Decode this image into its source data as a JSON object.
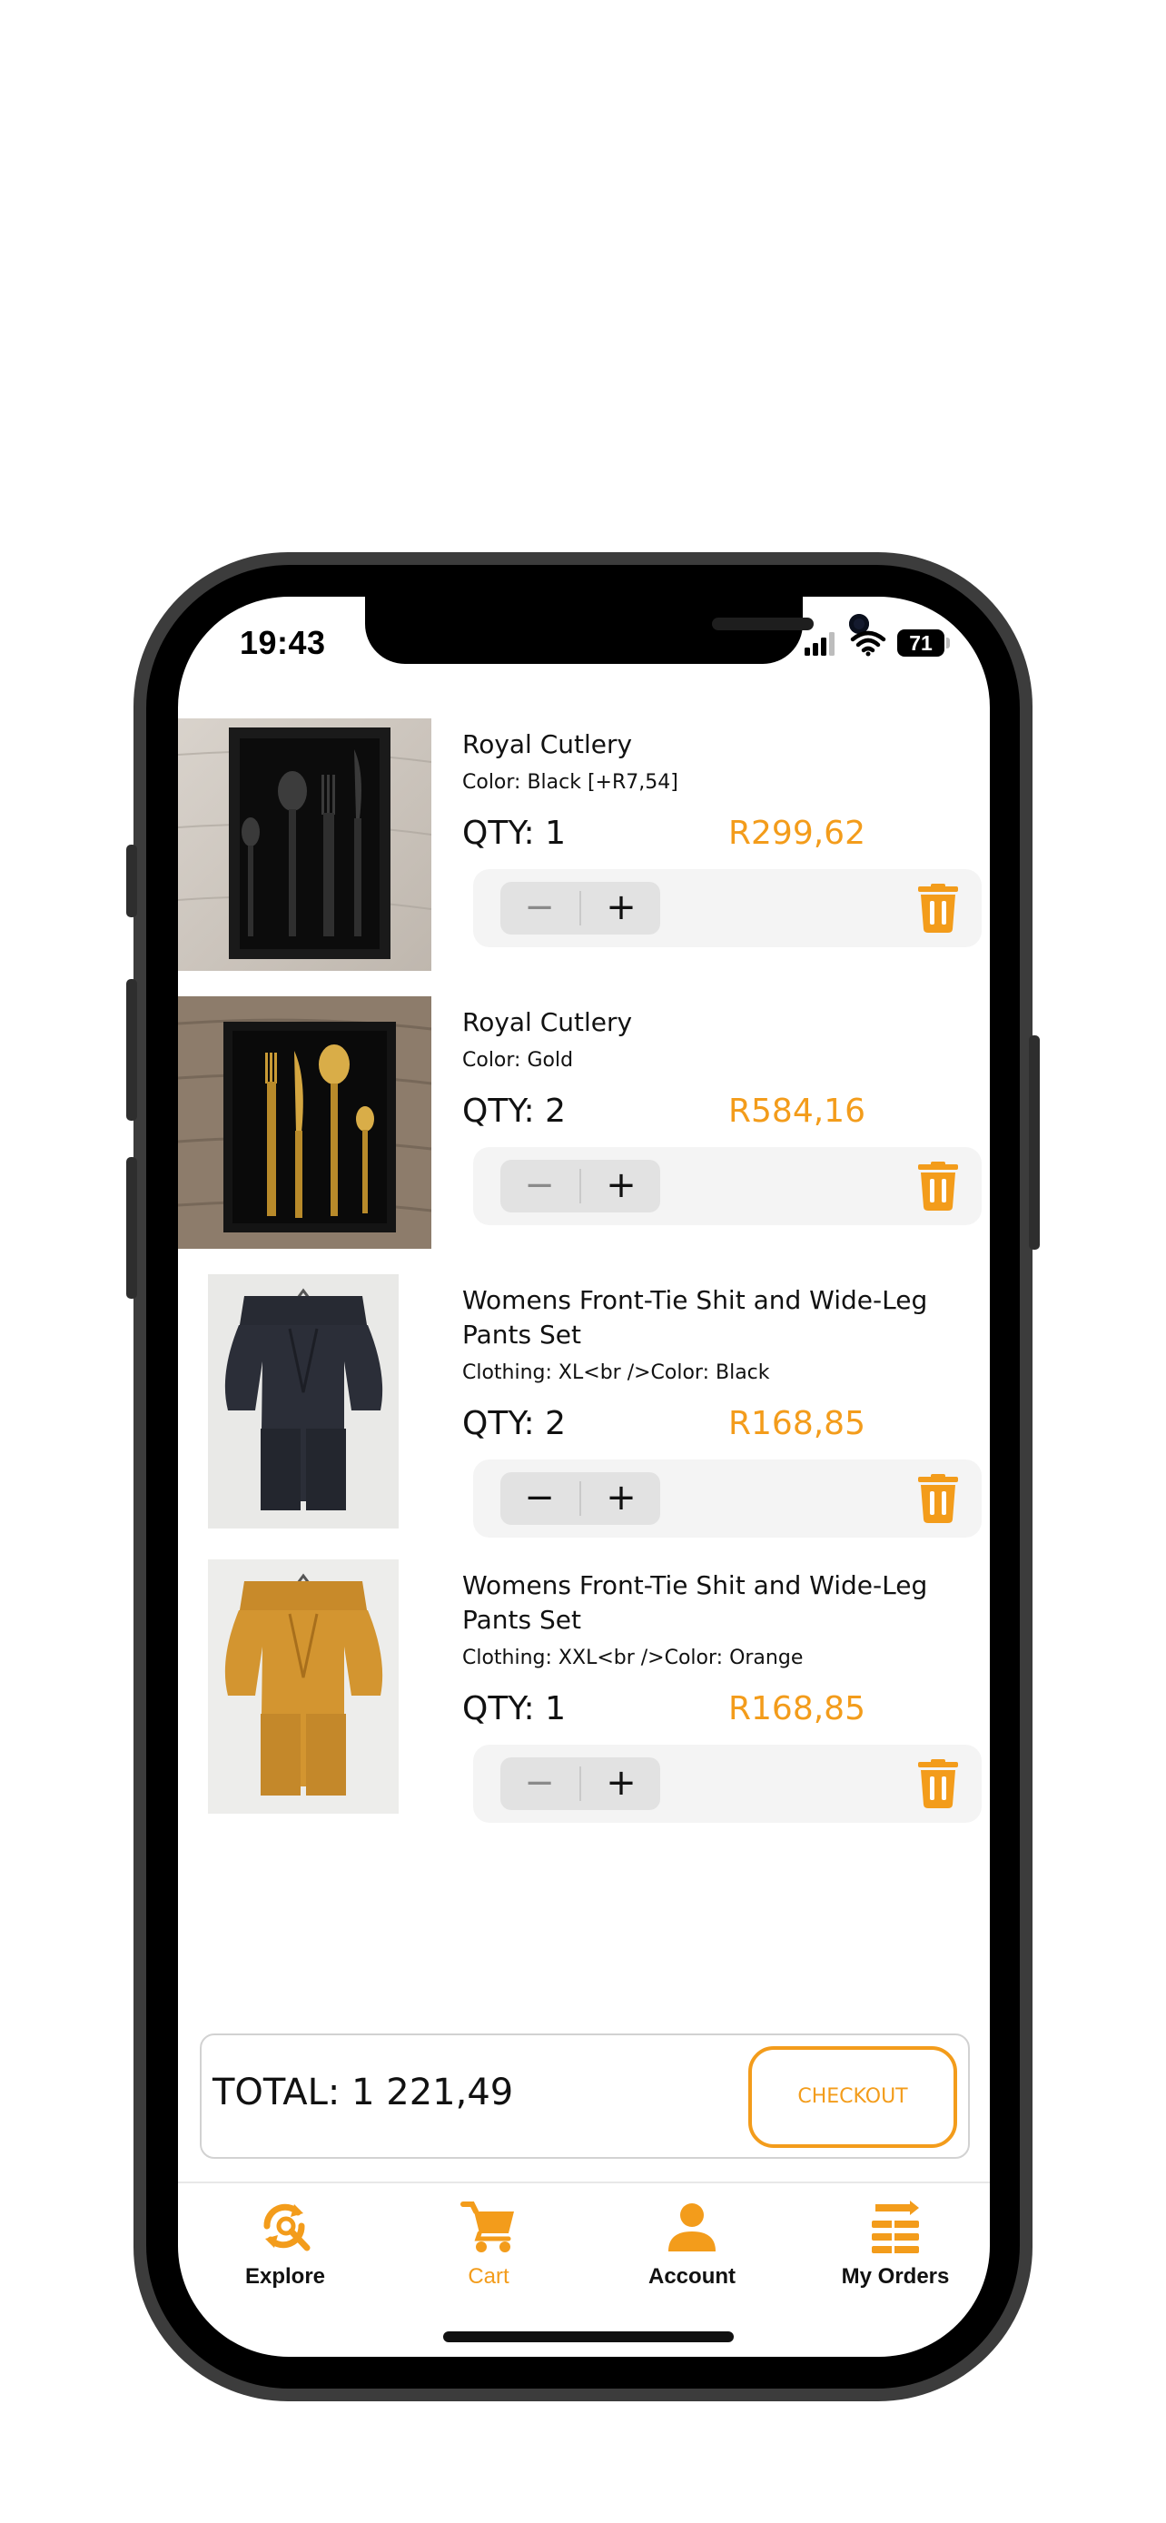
{
  "status_bar": {
    "time": "19:43",
    "battery": "71"
  },
  "colors": {
    "accent": "#f39c1b",
    "text": "#111111",
    "muted": "#8a8a8a"
  },
  "cart": {
    "items": [
      {
        "name": "Royal Cutlery",
        "variant": "Color: Black [+R7,54]",
        "qty": "QTY: 1",
        "price": "R299,62",
        "qty_value": 1,
        "minus_enabled": false
      },
      {
        "name": "Royal Cutlery",
        "variant": "Color: Gold",
        "qty": "QTY: 2",
        "price": "R584,16",
        "qty_value": 2,
        "minus_enabled": false
      },
      {
        "name": "Womens Front-Tie Shit and Wide-Leg Pants Set",
        "variant": "Clothing: XL<br />Color: Black",
        "qty": "QTY: 2",
        "price": "R168,85",
        "qty_value": 2,
        "minus_enabled": true
      },
      {
        "name": "Womens Front-Tie Shit and Wide-Leg Pants Set",
        "variant": "Clothing: XXL<br />Color: Orange",
        "qty": "QTY: 1",
        "price": "R168,85",
        "qty_value": 1,
        "minus_enabled": false
      }
    ],
    "stepper": {
      "minus": "−",
      "plus": "+"
    },
    "total_label": "TOTAL: 1 221,49",
    "checkout_label": "CHECKOUT"
  },
  "tabs": [
    {
      "label": "Explore",
      "icon": "explore-icon",
      "active": false
    },
    {
      "label": "Cart",
      "icon": "cart-icon",
      "active": true
    },
    {
      "label": "Account",
      "icon": "account-icon",
      "active": false
    },
    {
      "label": "My Orders",
      "icon": "my-orders-icon",
      "active": false
    }
  ]
}
